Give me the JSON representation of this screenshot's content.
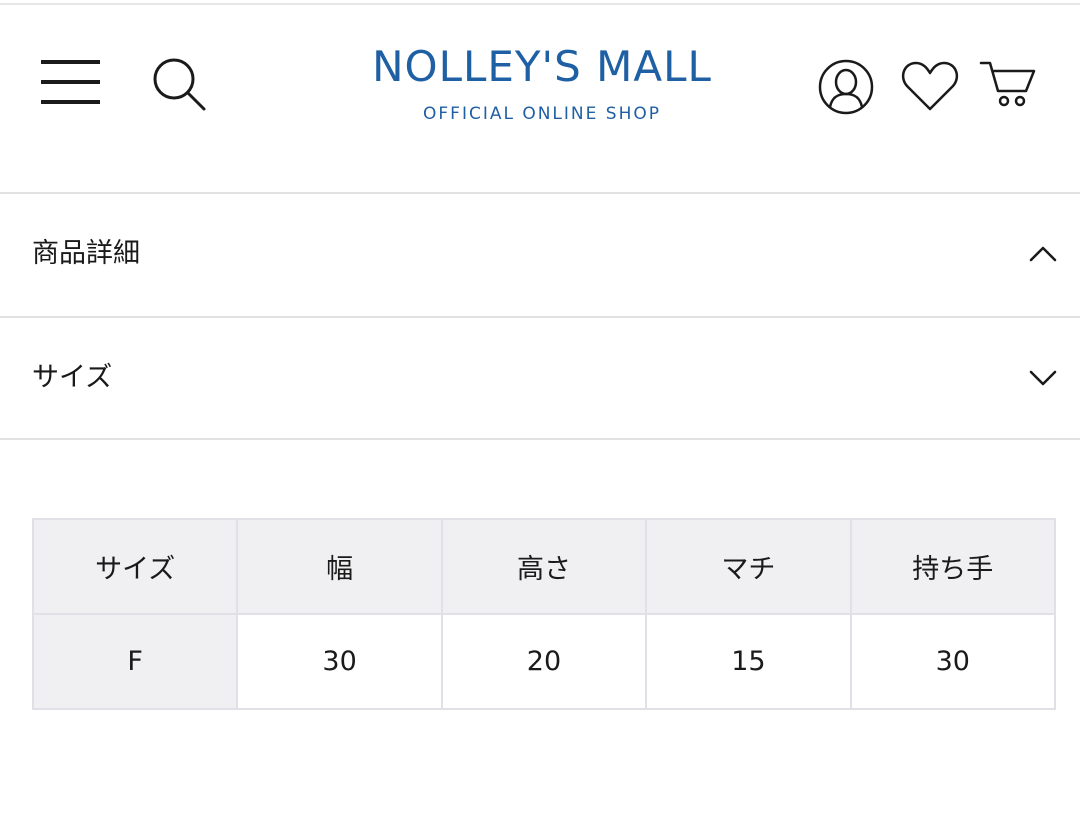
{
  "header": {
    "brand_name": "NOLLEY'S MALL",
    "brand_tagline": "OFFICIAL ONLINE SHOP",
    "brand_color": "#1f5fa3",
    "icons": [
      "menu-icon",
      "search-icon",
      "account-icon",
      "heart-icon",
      "cart-icon"
    ]
  },
  "accordion": {
    "items": [
      {
        "label": "商品詳細",
        "state": "expanded",
        "icon": "chevron-up-icon"
      },
      {
        "label": "サイズ",
        "state": "collapsed",
        "icon": "chevron-down-icon"
      }
    ]
  },
  "size_table": {
    "headers": [
      "サイズ",
      "幅",
      "高さ",
      "マチ",
      "持ち手"
    ],
    "rows": [
      [
        "F",
        "30",
        "20",
        "15",
        "30"
      ]
    ],
    "header_background": "#f0f0f2",
    "border_color": "#dfe1e6"
  }
}
